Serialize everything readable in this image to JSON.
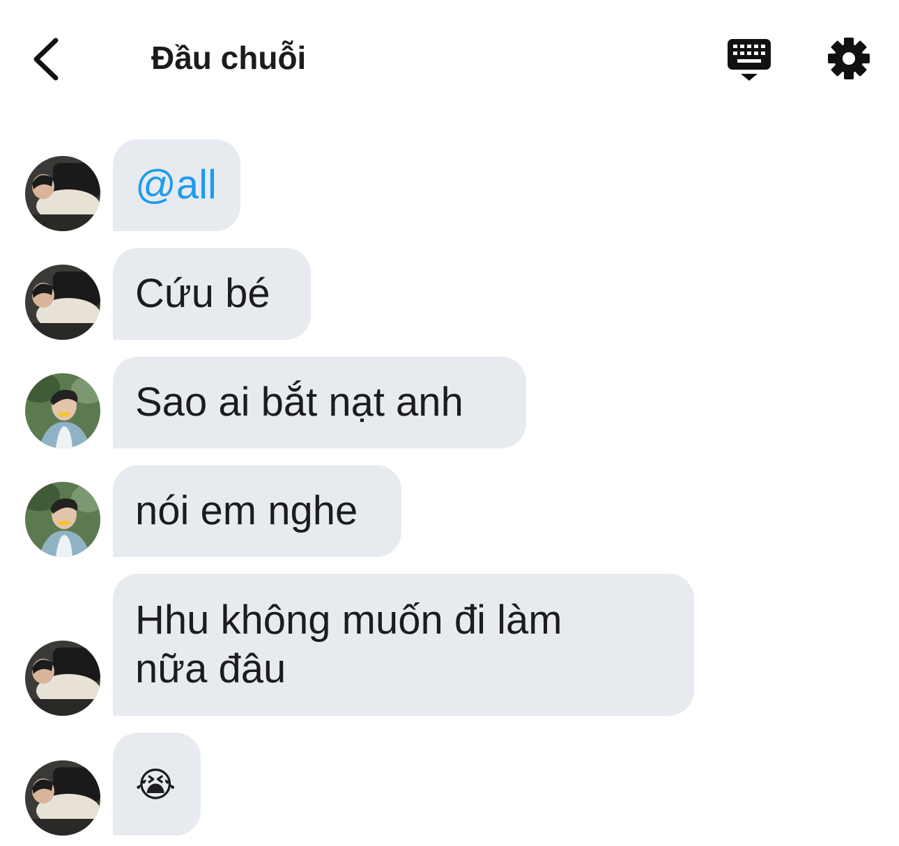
{
  "header": {
    "title": "Đầu chuỗi",
    "icons": [
      "back-chevron-icon",
      "keyboard-icon",
      "gear-icon"
    ]
  },
  "colors": {
    "bubble_bg": "#e7ebef",
    "mention": "#1d9bf0",
    "text": "#1c1c1e"
  },
  "messages": [
    {
      "text": "@all",
      "type": "mention",
      "avatar": "user-a"
    },
    {
      "text": "Cứu bé",
      "type": "text",
      "avatar": "user-a"
    },
    {
      "text": "Sao ai bắt nạt anh",
      "type": "text",
      "avatar": "user-b"
    },
    {
      "text": "nói em nghe",
      "type": "text",
      "avatar": "user-b"
    },
    {
      "text": "Hhu không muốn đi làm nữa đâu",
      "type": "text",
      "avatar": "user-a"
    },
    {
      "text": "😭",
      "type": "emoji",
      "avatar": "user-a"
    }
  ]
}
